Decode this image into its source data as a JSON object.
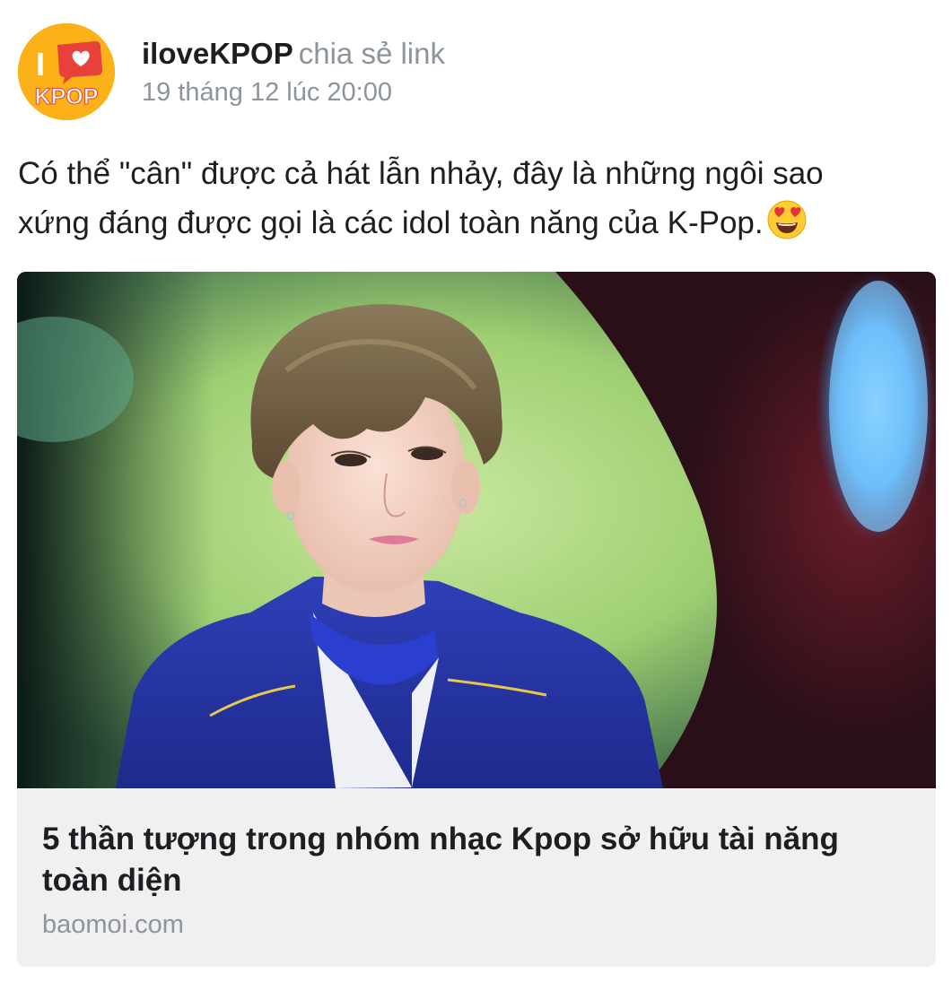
{
  "post": {
    "author": {
      "name": "iloveKPOP",
      "action": "chia sẻ link",
      "avatar_logo": {
        "top_letter": "I",
        "bottom_text": "KPOP",
        "background_color": "#fbb117",
        "heart_color": "#e8403a"
      }
    },
    "timestamp": "19 tháng 12 lúc 20:00",
    "text_line_1": "Có thể \"cân\" được cả hát lẫn nhảy, đây là những ngôi sao",
    "text_line_2": "xứng đáng được gọi là các idol toàn năng của K-Pop.",
    "emoji": "smiling-face-with-heart-eyes"
  },
  "link_preview": {
    "image": "photo-kpop-idol-blue-jacket",
    "title": "5 thần tượng trong nhóm nhạc Kpop sở hữu tài năng toàn diện",
    "domain": "baomoi.com"
  }
}
